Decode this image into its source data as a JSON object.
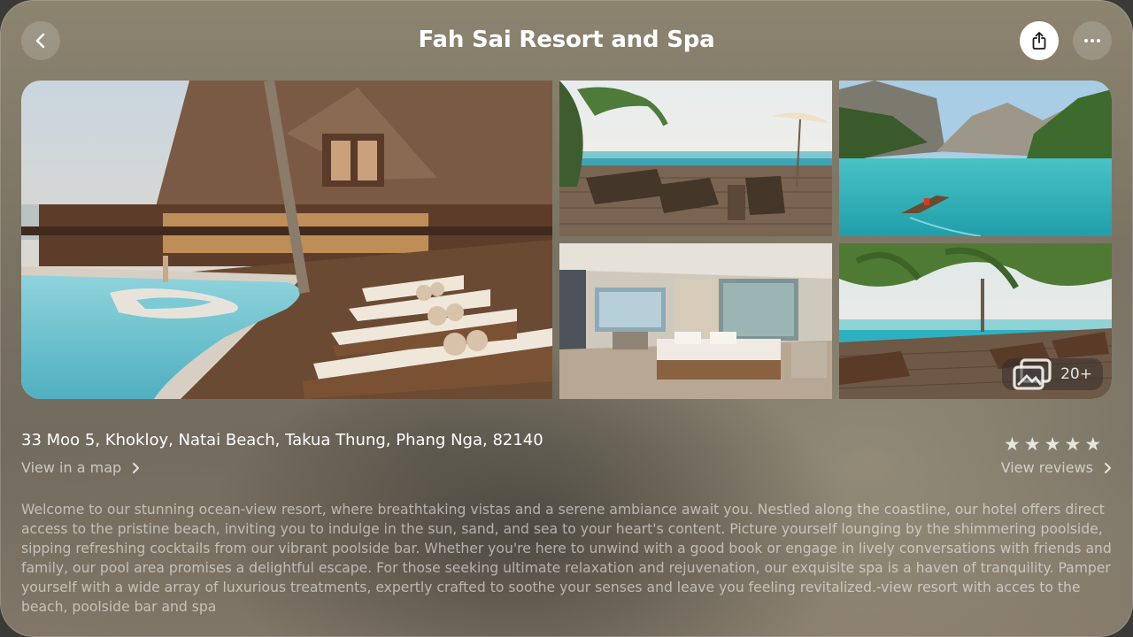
{
  "header": {
    "title": "Fah Sai Resort and Spa",
    "back_icon": "chevron-left-icon",
    "share_icon": "share-icon",
    "more_icon": "ellipsis-icon"
  },
  "gallery": {
    "more_count": "20+",
    "more_icon": "photo-stack-icon",
    "photos": [
      "resort-pool-and-lounge-chairs",
      "deck-with-sunbeds-and-umbrellas",
      "mountain-lake-with-boat",
      "bedroom-interior",
      "infinity-pool-by-the-sea"
    ]
  },
  "info": {
    "address": "33 Moo 5, Khokloy, Natai Beach, Takua Thung, Phang Nga, 82140",
    "map_link": "View in a map",
    "rating": 5,
    "rating_max": 5,
    "reviews_link": "View reviews",
    "description": "Welcome to our stunning ocean-view resort, where breathtaking vistas and a serene ambiance await you. Nestled along the coastline, our hotel offers direct access to the pristine beach, inviting you to indulge in the sun, sand, and sea to your heart's content. Picture yourself lounging by the shimmering poolside, sipping refreshing cocktails from our vibrant poolside bar. Whether you're here to unwind with a good book or engage in lively conversations with friends and family, our pool area promises a delightful escape. For those seeking ultimate relaxation and rejuvenation, our exquisite spa is a haven of tranquility. Pamper yourself with a wide array of luxurious treatments, expertly crafted to soothe your senses and leave you feeling revitalized.-view resort with acces to the beach, poolside bar and spa"
  },
  "colors": {
    "accent": "#ffffff",
    "pool": "#5fc0cf",
    "wood": "#6b4a33"
  }
}
